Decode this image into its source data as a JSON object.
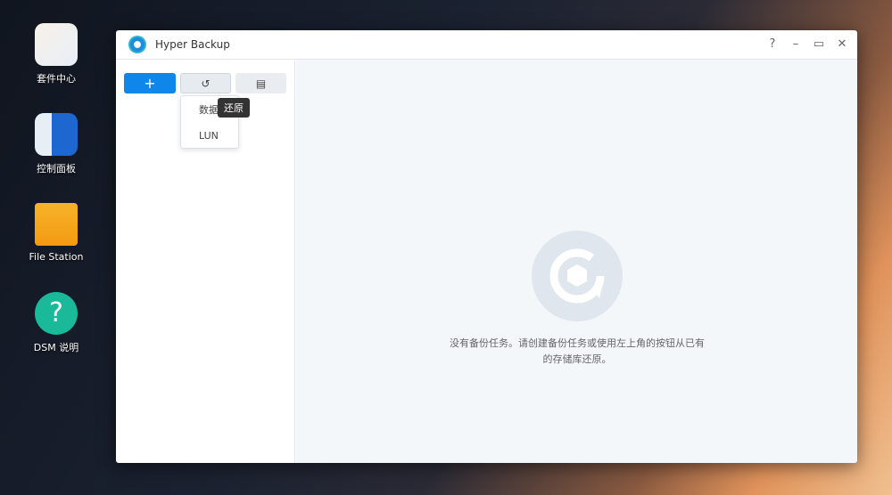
{
  "desktop": {
    "icons": [
      {
        "label": "套件中心"
      },
      {
        "label": "控制面板"
      },
      {
        "label": "File Station"
      },
      {
        "label": "DSM 说明"
      }
    ]
  },
  "window": {
    "title": "Hyper Backup",
    "controls": {
      "help": "?",
      "minimize": "–",
      "maximize": "▭",
      "close": "✕"
    }
  },
  "toolbar": {
    "add": "+",
    "restore_icon": "↺",
    "log_icon": "▤"
  },
  "restore_menu": {
    "items": [
      "数据",
      "LUN"
    ]
  },
  "tooltip": "还原",
  "main": {
    "empty_message": "没有备份任务。请创建备份任务或使用左上角的按钮从已有的存储库还原。"
  },
  "colors": {
    "accent": "#0f86e9"
  }
}
